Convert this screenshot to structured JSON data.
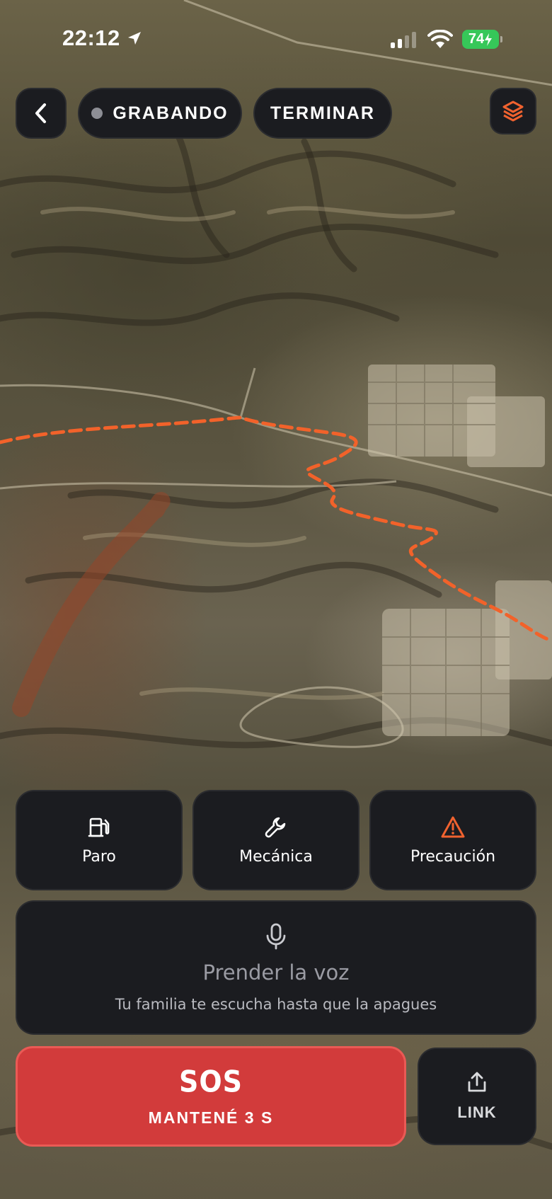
{
  "status_bar": {
    "time": "22:12",
    "battery": "74",
    "signal_bars_active": 2,
    "signal_bars_total": 4
  },
  "top_controls": {
    "recording_label": "GRABANDO",
    "end_label": "TERMINAR"
  },
  "quick_actions": [
    {
      "label": "Paro",
      "icon": "fuel-pump-icon",
      "color": "#ffffff"
    },
    {
      "label": "Mecánica",
      "icon": "wrench-icon",
      "color": "#ffffff"
    },
    {
      "label": "Precaución",
      "icon": "warning-icon",
      "color": "#f0622f"
    }
  ],
  "voice": {
    "title": "Prender la voz",
    "subtitle": "Tu familia te escucha hasta que la apagues"
  },
  "sos": {
    "title": "SOS",
    "subtitle": "MANTENÉ 3 S"
  },
  "share": {
    "label": "LINK"
  },
  "map": {
    "route_color": "#f2622a"
  },
  "colors": {
    "panel": "#1b1c20",
    "sos_red": "#d23b3b",
    "accent_orange": "#f0622f",
    "battery_green": "#36c759"
  }
}
